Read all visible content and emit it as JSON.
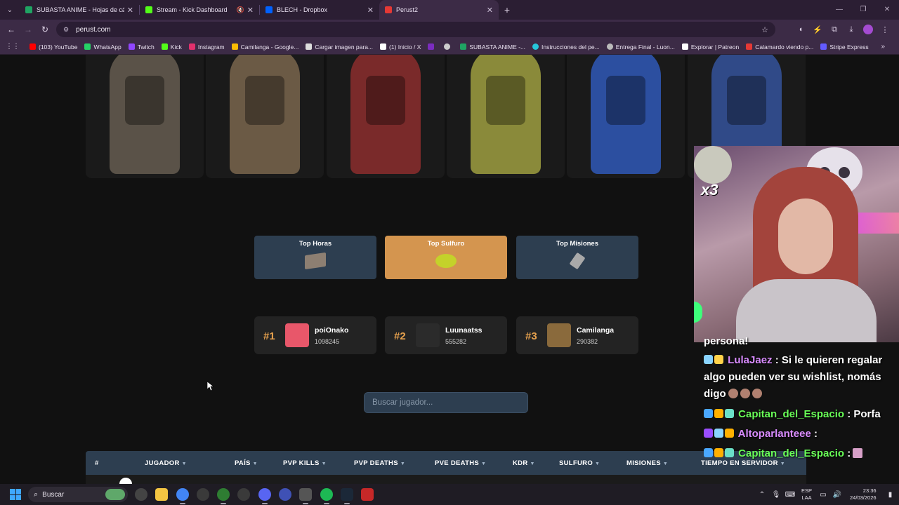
{
  "browser": {
    "tabs": [
      {
        "title": "SUBASTA ANIME - Hojas de cálc",
        "color": "#1fa463",
        "active": false
      },
      {
        "title": "Stream - Kick Dashboard",
        "color": "#53fc18",
        "active": false
      },
      {
        "title": "BLECH - Dropbox",
        "color": "#0061fe",
        "active": false
      },
      {
        "title": "Perust2",
        "color": "#e53935",
        "active": true
      }
    ],
    "url": "perust.com",
    "bookmarks": [
      {
        "label": "(103) YouTube",
        "color": "#ff0000"
      },
      {
        "label": "WhatsApp",
        "color": "#25d366"
      },
      {
        "label": "Twitch",
        "color": "#9146ff"
      },
      {
        "label": "Kick",
        "color": "#53fc18"
      },
      {
        "label": "Instagram",
        "color": "#e1306c"
      },
      {
        "label": "Camilanga - Google...",
        "color": "#fbbc04"
      },
      {
        "label": "Cargar imagen para...",
        "color": "#dddddd"
      },
      {
        "label": "(1) Inicio / X",
        "color": "#ffffff"
      },
      {
        "label": "",
        "color": "#7b2cbf"
      },
      {
        "label": "",
        "color": "#cccccc"
      },
      {
        "label": "SUBASTA ANIME -...",
        "color": "#1fa463"
      },
      {
        "label": "Instrucciones del pe...",
        "color": "#26c6da"
      },
      {
        "label": "Entrega Final - Luon...",
        "color": "#bbbbbb"
      },
      {
        "label": "Explorar | Patreon",
        "color": "#ffffff"
      },
      {
        "label": "Calamardo viendo p...",
        "color": "#e53935"
      },
      {
        "label": "Stripe Express",
        "color": "#635bff"
      }
    ]
  },
  "page": {
    "characters": [
      {
        "color": "#5a5248"
      },
      {
        "color": "#6b5a45"
      },
      {
        "color": "#7a2a2a"
      },
      {
        "color": "#8a8a3a"
      },
      {
        "color": "#2c4fa0"
      },
      {
        "color": "#304a88"
      }
    ],
    "top_buttons": [
      {
        "label": "Top Horas",
        "active": false,
        "img_color": "#8d7f72"
      },
      {
        "label": "Top Sulfuro",
        "active": true,
        "img_color": "#c4d22a"
      },
      {
        "label": "Top Misiones",
        "active": false,
        "img_color": "#a9a9a9"
      }
    ],
    "ranking": [
      {
        "rank": "#1",
        "name": "poiOnako",
        "score": "1098245",
        "avatar_color": "#e8576a"
      },
      {
        "rank": "#2",
        "name": "Luunaatss",
        "score": "555282",
        "avatar_color": "#2b2b2b"
      },
      {
        "rank": "#3",
        "name": "Camilanga",
        "score": "290382",
        "avatar_color": "#8a6a3c"
      }
    ],
    "search_placeholder": "Buscar jugador...",
    "table_headers": [
      "#",
      "JUGADOR",
      "PAÍS",
      "PVP KILLS",
      "PVP DEATHS",
      "PVE DEATHS",
      "KDR",
      "SULFURO",
      "MISIONES",
      "TIEMPO EN SERVIDOR"
    ],
    "sort_arrow": "▼"
  },
  "stream": {
    "multiplier": "x3",
    "chat": [
      {
        "user": "",
        "text": "persona!",
        "user_color": "#ffffff"
      },
      {
        "user": "LulaJaez",
        "text": " : Si le quieren regalar",
        "user_color": "#d98cff"
      },
      {
        "user": "",
        "text": "algo pueden ver su wishlist, nomás",
        "user_color": "#ffffff"
      },
      {
        "user": "",
        "text": "digo",
        "user_color": "#ffffff"
      },
      {
        "user": "Capitan_del_Espacio",
        "text": " : Porfa",
        "user_color": "#69ff57"
      },
      {
        "user": "Altoparlanteee",
        "text": " :",
        "user_color": "#d98cff"
      },
      {
        "user": "Capitan_del_Espacio",
        "text": " :",
        "user_color": "#69ff57"
      }
    ]
  },
  "taskbar": {
    "search_label": "Buscar",
    "lang_top": "ESP",
    "lang_bottom": "LAA",
    "time": "23:36",
    "date": "24/03/2026"
  }
}
